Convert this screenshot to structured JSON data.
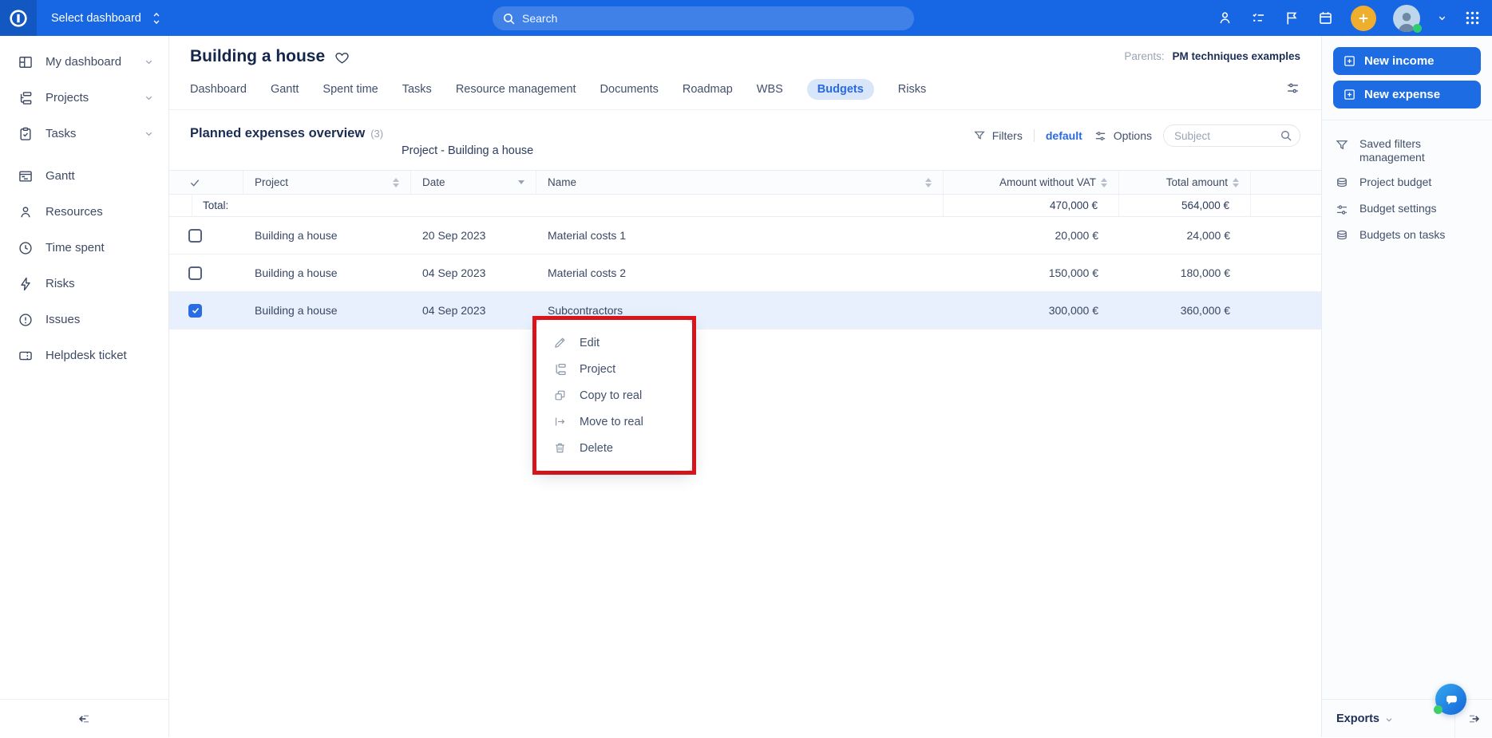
{
  "topbar": {
    "select_dashboard_label": "Select dashboard",
    "search_placeholder": "Search",
    "icons": [
      "person-icon",
      "checklist-icon",
      "flag-icon",
      "calendar-icon",
      "plus-icon",
      "user-avatar",
      "apps-grid-icon"
    ],
    "colors": {
      "bar": "#1766e3",
      "plus_button": "#efae2e",
      "presence": "#2ecc71"
    }
  },
  "sidebar": {
    "items": [
      {
        "label": "My dashboard",
        "icon": "dashboard-icon",
        "expandable": true
      },
      {
        "label": "Projects",
        "icon": "projects-tree-icon",
        "expandable": true
      },
      {
        "label": "Tasks",
        "icon": "tasks-clipboard-icon",
        "expandable": true
      },
      {
        "label": "Gantt",
        "icon": "gantt-icon",
        "expandable": false
      },
      {
        "label": "Resources",
        "icon": "person-icon",
        "expandable": false
      },
      {
        "label": "Time spent",
        "icon": "clock-icon",
        "expandable": false
      },
      {
        "label": "Risks",
        "icon": "lightning-icon",
        "expandable": false
      },
      {
        "label": "Issues",
        "icon": "alert-circle-icon",
        "expandable": false
      },
      {
        "label": "Helpdesk ticket",
        "icon": "ticket-icon",
        "expandable": false
      }
    ]
  },
  "header": {
    "title": "Building a house",
    "parents_label": "Parents:",
    "parents_value": "PM techniques examples",
    "tabs": [
      "Dashboard",
      "Gantt",
      "Spent time",
      "Tasks",
      "Resource management",
      "Documents",
      "Roadmap",
      "WBS",
      "Budgets",
      "Risks"
    ],
    "active_tab": "Budgets",
    "active_tab_colors": {
      "bg": "#d9e6fa",
      "text": "#2a6ae0"
    }
  },
  "toolbar": {
    "heading": "Planned expenses overview",
    "count": "(3)",
    "subtitle": "Project - Building a house",
    "filters_label": "Filters",
    "filters_value": "default",
    "options_label": "Options",
    "subject_placeholder": "Subject"
  },
  "table": {
    "columns": {
      "project": "Project",
      "date": "Date",
      "name": "Name",
      "amount_without_vat": "Amount without VAT",
      "total_amount": "Total amount"
    },
    "sort": {
      "date": "desc"
    },
    "total_label": "Total:",
    "totals": {
      "amount_without_vat": "470,000 €",
      "total_amount": "564,000 €"
    },
    "rows": [
      {
        "checked": false,
        "selected": false,
        "project": "Building a house",
        "date": "20 Sep 2023",
        "name": "Material costs 1",
        "amount_without_vat": "20,000 €",
        "total_amount": "24,000 €"
      },
      {
        "checked": false,
        "selected": false,
        "project": "Building a house",
        "date": "04 Sep 2023",
        "name": "Material costs 2",
        "amount_without_vat": "150,000 €",
        "total_amount": "180,000 €"
      },
      {
        "checked": true,
        "selected": true,
        "project": "Building a house",
        "date": "04 Sep 2023",
        "name": "Subcontractors",
        "amount_without_vat": "300,000 €",
        "total_amount": "360,000 €"
      }
    ],
    "selected_row_bg": "#e7f0fc"
  },
  "context_menu": {
    "highlight_color": "#e0151a",
    "items": [
      {
        "label": "Edit",
        "icon": "pencil-icon"
      },
      {
        "label": "Project",
        "icon": "tree-icon"
      },
      {
        "label": "Copy to real",
        "icon": "copy-icon"
      },
      {
        "label": "Move to real",
        "icon": "move-arrow-icon"
      },
      {
        "label": "Delete",
        "icon": "trash-icon"
      }
    ]
  },
  "right_panel": {
    "buttons": [
      {
        "label": "New income",
        "icon": "plus-square-icon",
        "bg": "#1d6ce3"
      },
      {
        "label": "New expense",
        "icon": "plus-square-icon",
        "bg": "#1d6ce3"
      }
    ],
    "links": [
      {
        "label": "Saved filters management",
        "icon": "funnel-icon"
      },
      {
        "label": "Project budget",
        "icon": "coins-icon"
      },
      {
        "label": "Budget settings",
        "icon": "sliders-icon"
      },
      {
        "label": "Budgets on tasks",
        "icon": "coins-icon"
      }
    ],
    "exports_label": "Exports"
  }
}
